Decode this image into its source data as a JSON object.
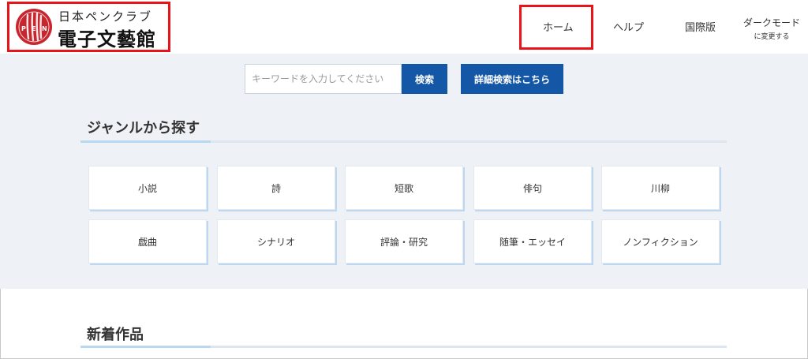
{
  "header": {
    "logo_subtitle": "日本ペンクラブ",
    "logo_title": "電子文藝館",
    "seal_letters": "PEN"
  },
  "nav": {
    "home": "ホーム",
    "help": "ヘルプ",
    "international": "国際版",
    "dark_mode_line1": "ダークモード",
    "dark_mode_line2": "に変更する"
  },
  "search": {
    "placeholder": "キーワードを入力してください",
    "button": "検索",
    "advanced_button": "詳細検索はこちら"
  },
  "genre": {
    "title": "ジャンルから探す",
    "items": [
      {
        "label": "小説"
      },
      {
        "label": "詩"
      },
      {
        "label": "短歌"
      },
      {
        "label": "俳句"
      },
      {
        "label": "川柳"
      },
      {
        "label": "戯曲"
      },
      {
        "label": "シナリオ"
      },
      {
        "label": "評論・研究"
      },
      {
        "label": "随筆・エッセイ"
      },
      {
        "label": "ノンフィクション"
      }
    ]
  },
  "new_works": {
    "title": "新着作品"
  },
  "colors": {
    "accent_blue": "#1357a6",
    "highlight_red": "#e8141a",
    "section_bg": "#eef2f7"
  }
}
